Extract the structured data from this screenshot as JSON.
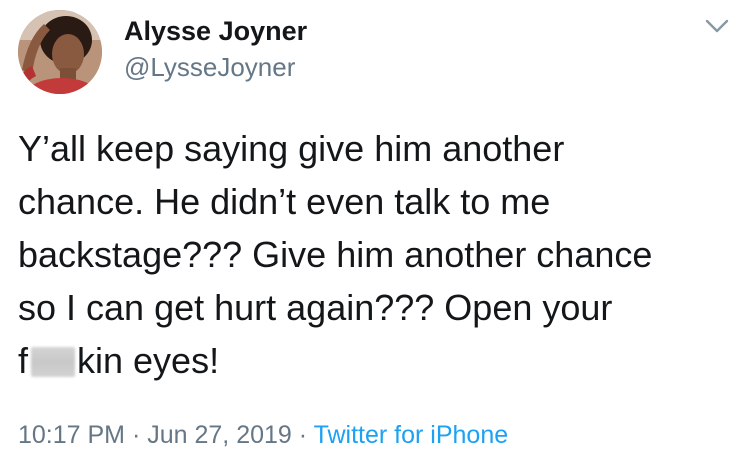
{
  "author": {
    "name": "Alysse Joyner",
    "handle": "@LysseJoyner"
  },
  "tweet": {
    "lines": [
      "Y’all keep saying give him another",
      "chance. He didn’t even talk to me",
      "backstage??? Give him another chance",
      "so I can get hurt again??? Open your"
    ],
    "last_line_start": "f",
    "last_line_end": "kin eyes!"
  },
  "meta": {
    "time": "10:17 PM",
    "separator": "·",
    "date": "Jun 27, 2019",
    "source": "Twitter for iPhone"
  },
  "icons": {
    "more": "chevron-down-icon"
  },
  "colors": {
    "text": "#14171a",
    "secondary": "#657786",
    "link": "#1da1f2"
  }
}
